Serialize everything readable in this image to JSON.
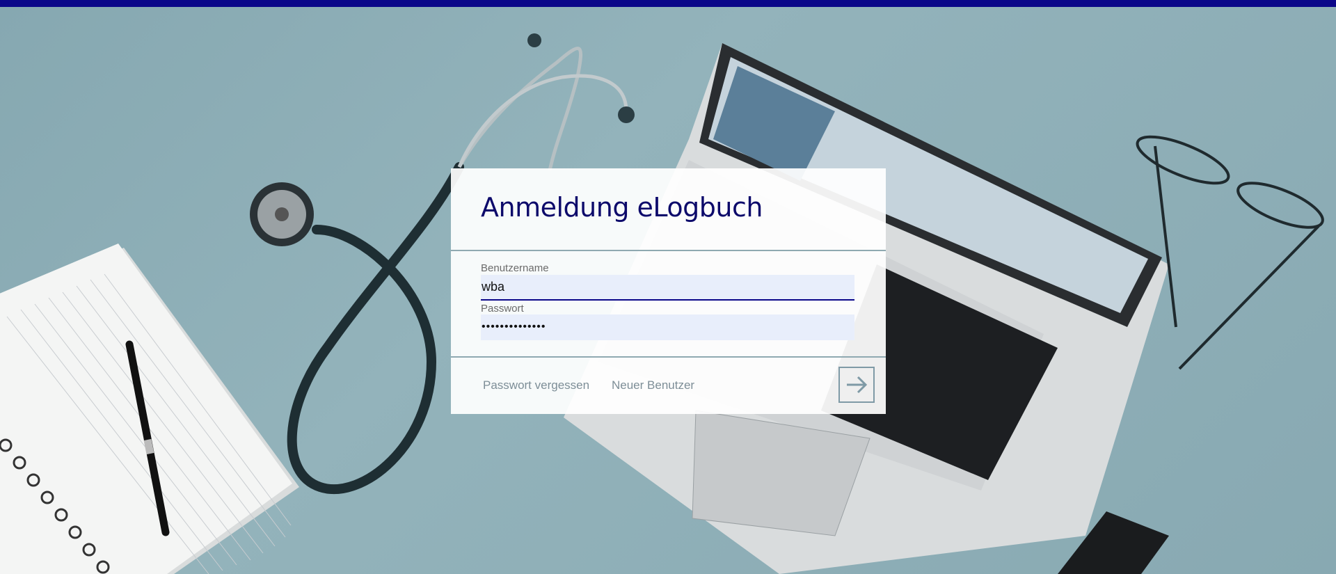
{
  "page": {
    "title": "Anmeldung eLogbuch",
    "accent_color": "#0b0789"
  },
  "login": {
    "username_label": "Benutzername",
    "username_value": "wba",
    "password_label": "Passwort",
    "password_value": "••••••••••••••",
    "forgot_password_label": "Passwort vergessen",
    "new_user_label": "Neuer Benutzer",
    "submit_icon": "arrow-right-icon"
  }
}
